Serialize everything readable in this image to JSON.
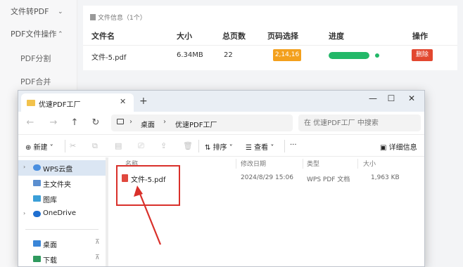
{
  "app": {
    "sidebar": {
      "items": [
        {
          "label": "文件转PDF",
          "chevron": "chevron-down"
        },
        {
          "label": "PDF文件操作",
          "chevron": "chevron-up"
        }
      ],
      "subitems": [
        "PDF分割",
        "PDF合并"
      ]
    },
    "file_panel": {
      "header": "文件信息（1个）",
      "columns": [
        "文件名",
        "大小",
        "总页数",
        "页码选择",
        "进度",
        "操作"
      ],
      "row": {
        "name": "文件-5.pdf",
        "size": "6.34MB",
        "pages": "22",
        "page_range": "2,14,16",
        "progress": 1.0,
        "action": "删除"
      },
      "colors": {
        "badge": "#f3a01d",
        "progress": "#22b868",
        "delete": "#e2472f"
      }
    }
  },
  "explorer": {
    "tab_title": "优速PDF工厂",
    "new_tab": "+",
    "window_controls": [
      "—",
      "☐",
      "✕"
    ],
    "nav_icons": [
      "←",
      "→",
      "↑",
      "↻"
    ],
    "breadcrumb": [
      "桌面",
      "优速PDF工厂"
    ],
    "breadcrumb_sep": "›",
    "search_placeholder": "在 优速PDF工厂 中搜索",
    "toolbar": {
      "new": "新建",
      "new_caret": "˅",
      "sort": "排序",
      "view": "查看",
      "more": "···",
      "details": "详细信息"
    },
    "nav_pane": [
      {
        "label": "WPS云盘",
        "arrow": "›",
        "icon": "cloud-icon",
        "selected": true
      },
      {
        "label": "主文件夹",
        "arrow": "",
        "icon": "home-icon",
        "selected": false
      },
      {
        "label": "图库",
        "arrow": "",
        "icon": "gallery-icon",
        "selected": false
      },
      {
        "label": "OneDrive",
        "arrow": "›",
        "icon": "onedrive-icon",
        "selected": false
      },
      {
        "label": "桌面",
        "arrow": "",
        "icon": "desktop-icon",
        "selected": false,
        "pin": "⊼"
      },
      {
        "label": "下载",
        "arrow": "",
        "icon": "download-icon",
        "selected": false,
        "pin": "⊼"
      }
    ],
    "columns": [
      "名称",
      "修改日期",
      "类型",
      "大小"
    ],
    "file": {
      "name": "文件-5.pdf",
      "modified": "2024/8/29 15:06",
      "type": "WPS PDF 文档",
      "size": "1,963 KB"
    },
    "colors": {
      "highlight": "#d9302a",
      "folder": "#f2c24c",
      "pdf": "#e0483e",
      "selected_row": "#dbe6f3"
    }
  }
}
